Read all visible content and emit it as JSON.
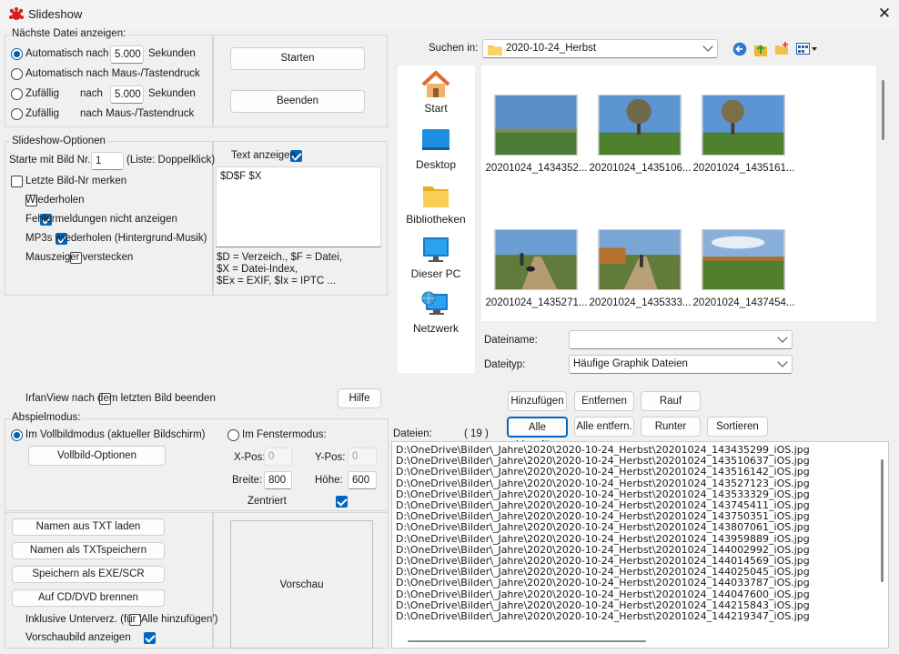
{
  "window": {
    "title": "Slideshow",
    "close_glyph": "✕"
  },
  "next_file": {
    "legend": "Nächste Datei anzeigen:",
    "opt1": {
      "label": "Automatisch nach",
      "value": "5.000",
      "unit": "Sekunden"
    },
    "opt2": {
      "label": "Automatisch nach Maus-/Tastendruck"
    },
    "opt3": {
      "label": "Zufällig",
      "mid": "nach",
      "value": "5.000",
      "unit": "Sekunden"
    },
    "opt4": {
      "label": "Zufällig",
      "mid": "nach Maus-/Tastendruck"
    }
  },
  "buttons": {
    "start": "Starten",
    "stop": "Beenden",
    "help": "Hilfe"
  },
  "options": {
    "legend": "Slideshow-Optionen",
    "start_label": "Starte mit Bild Nr.:",
    "start_value": "1",
    "start_hint": "(Liste: Doppelklick)",
    "remember": "Letzte Bild-Nr merken",
    "repeat": "Wiederholen",
    "no_errors": "Fehlermeldungen nicht anzeigen",
    "mp3": "MP3s wiederholen (Hintergrund-Musik)",
    "hide_cursor": "Mauszeiger verstecken",
    "show_text": "Text anzeigen",
    "text_value": "$D$F $X",
    "help1": "$D = Verzeich., $F = Datei,",
    "help2": "$X = Datei-Index,",
    "help3": "$Ex = EXIF, $Ix = IPTC ..."
  },
  "exit_after": "IrfanView nach dem letzten Bild beenden",
  "playback": {
    "legend": "Abspielmodus:",
    "fullscreen": "Im Vollbildmodus (aktueller Bildschirm)",
    "fullscreen_options": "Vollbild-Optionen",
    "window_mode": "Im Fenstermodus:",
    "xpos_label": "X-Pos:",
    "xpos": "0",
    "ypos_label": "Y-Pos:",
    "ypos": "0",
    "width_label": "Breite:",
    "width": "800",
    "height_label": "Höhe:",
    "height": "600",
    "center": "Zentriert"
  },
  "bottom_buttons": {
    "load_txt": "Namen aus TXT laden",
    "save_txt": "Namen als TXTspeichern",
    "save_exe": "Speichern als EXE/SCR",
    "burn": "Auf CD/DVD brennen",
    "subfolders": "Inklusive Unterverz. (für 'Alle hinzufügen')",
    "preview_check": "Vorschaubild anzeigen",
    "preview": "Vorschau"
  },
  "browser": {
    "look_in_label": "Suchen in:",
    "folder": "2020-10-24_Herbst",
    "places": [
      "Start",
      "Desktop",
      "Bibliotheken",
      "Dieser PC",
      "Netzwerk"
    ],
    "thumbs": [
      "20201024_1434352...",
      "20201024_1435106...",
      "20201024_1435161...",
      "20201024_1435271...",
      "20201024_1435333...",
      "20201024_1437454..."
    ],
    "filename_label": "Dateiname:",
    "filename": "",
    "filetype_label": "Dateityp:",
    "filetype": "Häufige Graphik Dateien"
  },
  "list_buttons": {
    "add": "Hinzufügen",
    "remove": "Entfernen",
    "up": "Rauf",
    "add_all": "Alle hinzufüg.",
    "remove_all": "Alle entfern.",
    "down": "Runter",
    "sort": "Sortieren"
  },
  "files": {
    "label": "Dateien:",
    "count": "( 19 )",
    "items": [
      "D:\\OneDrive\\Bilder\\_Jahre\\2020\\2020-10-24_Herbst\\20201024_143435299_iOS.jpg",
      "D:\\OneDrive\\Bilder\\_Jahre\\2020\\2020-10-24_Herbst\\20201024_143510637_iOS.jpg",
      "D:\\OneDrive\\Bilder\\_Jahre\\2020\\2020-10-24_Herbst\\20201024_143516142_iOS.jpg",
      "D:\\OneDrive\\Bilder\\_Jahre\\2020\\2020-10-24_Herbst\\20201024_143527123_iOS.jpg",
      "D:\\OneDrive\\Bilder\\_Jahre\\2020\\2020-10-24_Herbst\\20201024_143533329_iOS.jpg",
      "D:\\OneDrive\\Bilder\\_Jahre\\2020\\2020-10-24_Herbst\\20201024_143745411_iOS.jpg",
      "D:\\OneDrive\\Bilder\\_Jahre\\2020\\2020-10-24_Herbst\\20201024_143750351_iOS.jpg",
      "D:\\OneDrive\\Bilder\\_Jahre\\2020\\2020-10-24_Herbst\\20201024_143807061_iOS.jpg",
      "D:\\OneDrive\\Bilder\\_Jahre\\2020\\2020-10-24_Herbst\\20201024_143959889_iOS.jpg",
      "D:\\OneDrive\\Bilder\\_Jahre\\2020\\2020-10-24_Herbst\\20201024_144002992_iOS.jpg",
      "D:\\OneDrive\\Bilder\\_Jahre\\2020\\2020-10-24_Herbst\\20201024_144014569_iOS.jpg",
      "D:\\OneDrive\\Bilder\\_Jahre\\2020\\2020-10-24_Herbst\\20201024_144025045_iOS.jpg",
      "D:\\OneDrive\\Bilder\\_Jahre\\2020\\2020-10-24_Herbst\\20201024_144033787_iOS.jpg",
      "D:\\OneDrive\\Bilder\\_Jahre\\2020\\2020-10-24_Herbst\\20201024_144047600_iOS.jpg",
      "D:\\OneDrive\\Bilder\\_Jahre\\2020\\2020-10-24_Herbst\\20201024_144215843_iOS.jpg",
      "D:\\OneDrive\\Bilder\\_Jahre\\2020\\2020-10-24_Herbst\\20201024_144219347_iOS.jpg"
    ]
  }
}
